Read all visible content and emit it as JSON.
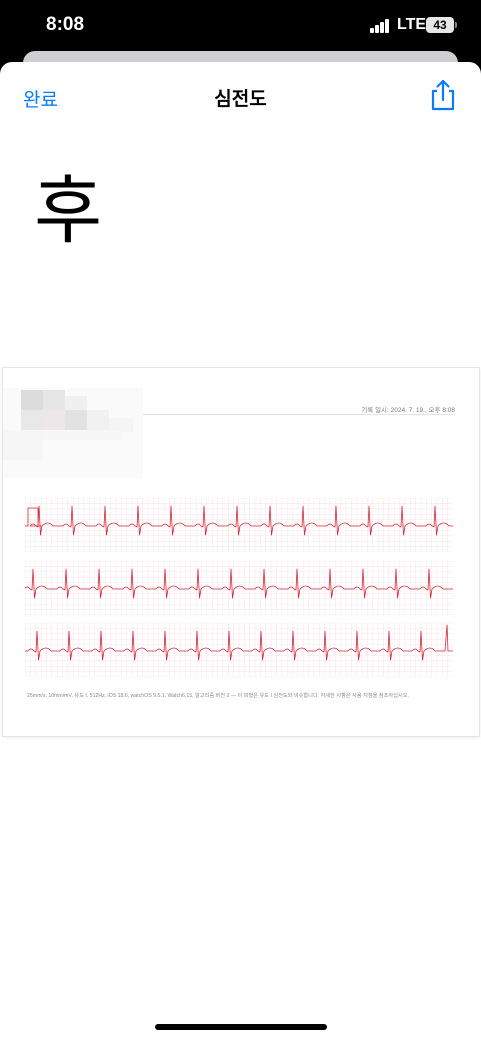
{
  "status_bar": {
    "time": "8:08",
    "network": "LTE",
    "battery": "43"
  },
  "nav": {
    "done_label": "완료",
    "title": "심전도"
  },
  "annotation": {
    "character": "후"
  },
  "document": {
    "recorded_at": "기록 일시: 2024. 7. 19., 오후 8:08",
    "footer": "25mm/s, 10mm/mV, 유도 I, 512Hz, iOS 18.6, watchOS 9.5.1, Watch6,15, 알고리즘 버전 2 — 이 파형은 유도 I 심전도와 비슷합니다. 자세한 사항은 사용 지침을 참조하십시오.",
    "waveform_color": "#d42a3c",
    "grid_color": "#f1c9ce"
  }
}
